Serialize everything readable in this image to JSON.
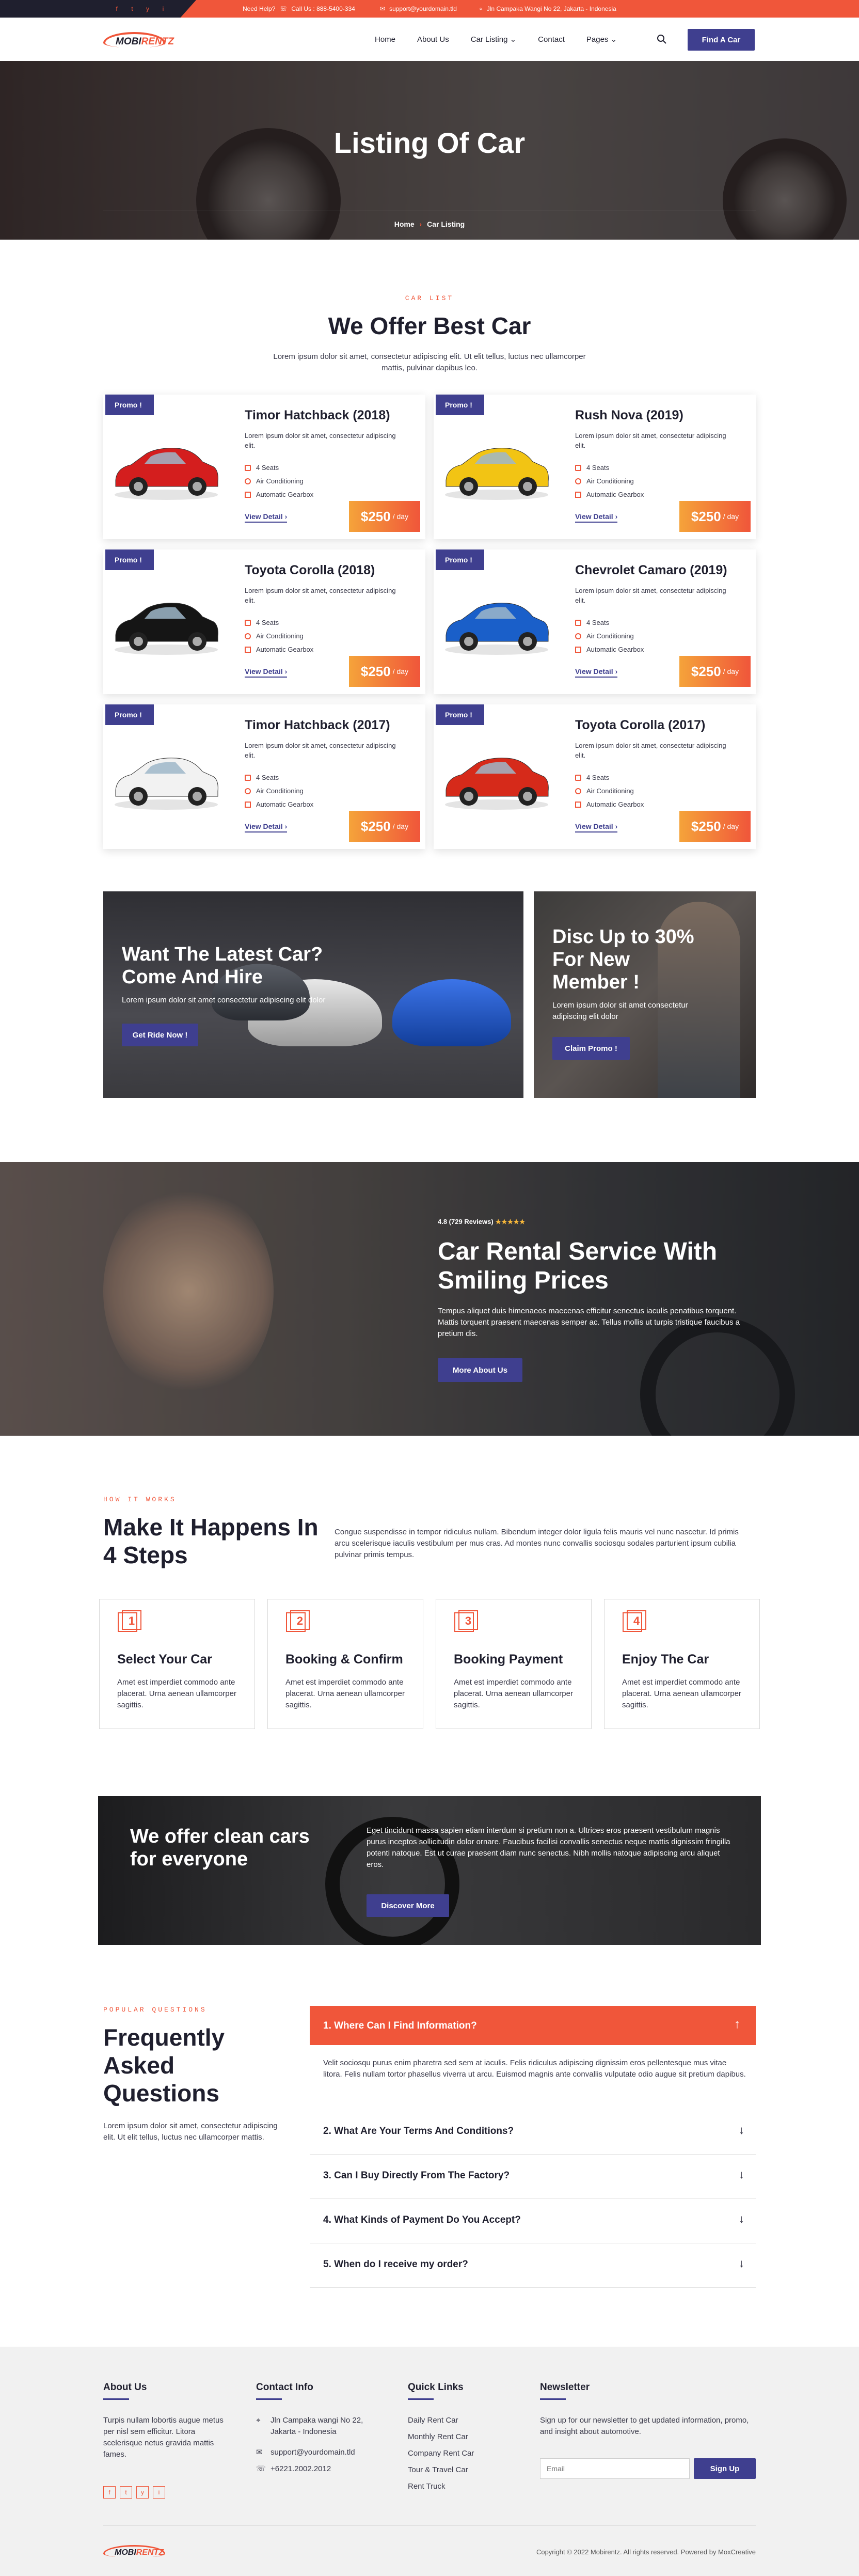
{
  "topbar": {
    "help": "Need Help?",
    "phone": "Call Us : 888-5400-334",
    "email": "support@yourdomain.tld",
    "address": "Jln Campaka Wangi No 22, Jakarta - Indonesia",
    "social": [
      "f",
      "t",
      "y",
      "i"
    ]
  },
  "nav": {
    "logo_a": "MOBI",
    "logo_b": "RENTZ",
    "items": [
      "Home",
      "About Us",
      "Car Listing",
      "Contact",
      "Pages"
    ],
    "cta": "Find A Car"
  },
  "hero": {
    "title": "Listing Of Car",
    "crumb_home": "Home",
    "crumb_current": "Car Listing"
  },
  "listing": {
    "kicker": "CAR LIST",
    "title": "We Offer Best Car",
    "intro": "Lorem ipsum dolor sit amet, consectetur adipiscing elit. Ut elit tellus, luctus nec ullamcorper mattis, pulvinar dapibus leo.",
    "promo_label": "Promo !",
    "detail_label": "View Detail",
    "price_unit": "/ day",
    "cars": [
      {
        "name": "Timor Hatchback (2018)",
        "desc": "Lorem ipsum dolor sit amet, consectetur adipiscing elit.",
        "seats": "4 Seats",
        "ac": "Air Conditioning",
        "gear": "Automatic Gearbox",
        "price": "$250",
        "color": "#d41e1e"
      },
      {
        "name": "Rush Nova (2019)",
        "desc": "Lorem ipsum dolor sit amet, consectetur adipiscing elit.",
        "seats": "4 Seats",
        "ac": "Air Conditioning",
        "gear": "Automatic Gearbox",
        "price": "$250",
        "color": "#f2c414"
      },
      {
        "name": "Toyota Corolla (2018)",
        "desc": "Lorem ipsum dolor sit amet, consectetur adipiscing elit.",
        "seats": "4 Seats",
        "ac": "Air Conditioning",
        "gear": "Automatic Gearbox",
        "price": "$250",
        "color": "#151515"
      },
      {
        "name": "Chevrolet Camaro (2019)",
        "desc": "Lorem ipsum dolor sit amet, consectetur adipiscing elit.",
        "seats": "4 Seats",
        "ac": "Air Conditioning",
        "gear": "Automatic Gearbox",
        "price": "$250",
        "color": "#1a5fc9"
      },
      {
        "name": "Timor Hatchback (2017)",
        "desc": "Lorem ipsum dolor sit amet, consectetur adipiscing elit.",
        "seats": "4 Seats",
        "ac": "Air Conditioning",
        "gear": "Automatic Gearbox",
        "price": "$250",
        "color": "#f2f2f2"
      },
      {
        "name": "Toyota Corolla (2017)",
        "desc": "Lorem ipsum dolor sit amet, consectetur adipiscing elit.",
        "seats": "4 Seats",
        "ac": "Air Conditioning",
        "gear": "Automatic Gearbox",
        "price": "$250",
        "color": "#d62a1a"
      }
    ]
  },
  "banners": {
    "left_title": "Want The Latest Car? Come And Hire",
    "left_text": "Lorem ipsum dolor sit amet consectetur adipiscing elit dolor",
    "left_button": "Get Ride Now !",
    "right_title": "Disc Up to 30% For New Member !",
    "right_text": "Lorem ipsum dolor sit amet consectetur adipiscing elit dolor",
    "right_button": "Claim Promo !"
  },
  "service": {
    "rating": "4.8 (729 Reviews)",
    "stars": "★★★★★",
    "title": "Car Rental Service With Smiling Prices",
    "text": "Tempus aliquet duis himenaeos maecenas efficitur senectus iaculis penatibus torquent. Mattis torquent praesent maecenas semper ac. Tellus mollis ut turpis tristique faucibus a pretium dis.",
    "button": "More About Us"
  },
  "how": {
    "kicker": "HOW IT WORKS",
    "title": "Make It Happens In 4 Steps",
    "intro": "Congue suspendisse in tempor ridiculus nullam. Bibendum integer dolor ligula felis mauris vel nunc nascetur. Id primis arcu scelerisque iaculis vestibulum per mus cras. Ad montes nunc convallis sociosqu sodales parturient ipsum cubilia pulvinar primis tempus.",
    "steps": [
      {
        "num": "1",
        "title": "Select Your Car",
        "text": "Amet est imperdiet commodo ante placerat. Urna aenean ullamcorper sagittis."
      },
      {
        "num": "2",
        "title": "Booking & Confirm",
        "text": "Amet est imperdiet commodo ante placerat. Urna aenean ullamcorper sagittis."
      },
      {
        "num": "3",
        "title": "Booking Payment",
        "text": "Amet est imperdiet commodo ante placerat. Urna aenean ullamcorper sagittis."
      },
      {
        "num": "4",
        "title": "Enjoy The Car",
        "text": "Amet est imperdiet commodo ante placerat. Urna aenean ullamcorper sagittis."
      }
    ]
  },
  "clean": {
    "title": "We offer clean cars for everyone",
    "text": "Eget tincidunt massa sapien etiam interdum si pretium non a. Ultrices eros praesent vestibulum magnis purus inceptos sollicitudin dolor ornare. Faucibus facilisi convallis senectus neque mattis dignissim fringilla potenti natoque. Est ut curae praesent diam nunc senectus. Nibh mollis natoque adipiscing arcu aliquet eros.",
    "button": "Discover More"
  },
  "faq": {
    "kicker": "POPULAR QUESTIONS",
    "title": "Frequently Asked Questions",
    "intro": "Lorem ipsum dolor sit amet, consectetur adipiscing elit. Ut elit tellus, luctus nec ullamcorper mattis.",
    "open_question": "1. Where Can I Find Information?",
    "open_answer": "Velit sociosqu purus enim pharetra sed sem at iaculis. Felis ridiculus adipiscing dignissim eros pellentesque mus vitae litora. Felis nullam tortor phasellus viverra ut arcu. Euismod magnis ante convallis vulputate odio augue sit pretium dapibus.",
    "questions": [
      "2. What Are Your Terms And Conditions?",
      "3. Can I Buy Directly From The Factory?",
      "4. What Kinds of Payment Do You Accept?",
      "5. When do I receive my order?"
    ]
  },
  "footer": {
    "about_title": "About Us",
    "about_text": "Turpis nullam lobortis augue metus per nisl sem efficitur. Litora scelerisque netus gravida mattis fames.",
    "social": [
      "f",
      "t",
      "y",
      "i"
    ],
    "contact_title": "Contact Info",
    "contact_address": "Jln Campaka wangi No 22, Jakarta - Indonesia",
    "contact_email": "support@yourdomain.tld",
    "contact_phone": "+6221.2002.2012",
    "links_title": "Quick Links",
    "links": [
      "Daily Rent Car",
      "Monthly Rent Car",
      "Company Rent Car",
      "Tour & Travel Car",
      "Rent Truck"
    ],
    "news_title": "Newsletter",
    "news_text": "Sign up for our newsletter to get updated information, promo, and insight about automotive.",
    "news_placeholder": "Email",
    "news_button": "Sign Up",
    "copyright": "Copyright © 2022 Mobirentz. All rights reserved. Powered by MoxCreative"
  },
  "colors": {
    "accent": "#f0563a",
    "navy": "#3f3f8f",
    "dark": "#1f1f2e"
  }
}
